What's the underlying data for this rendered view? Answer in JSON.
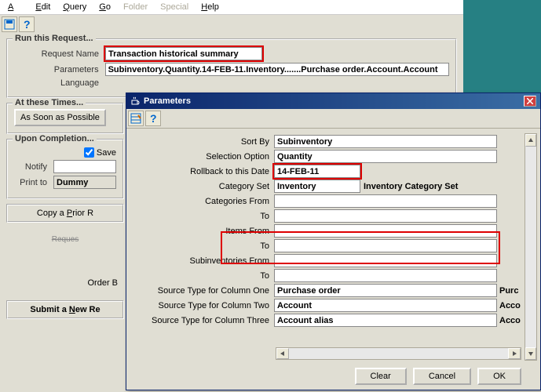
{
  "menubar": {
    "action": "Action",
    "edit": "Edit",
    "query": "Query",
    "go": "Go",
    "folder": "Folder",
    "special": "Special",
    "help": "Help"
  },
  "group_run": {
    "title": "Run this Request...",
    "request_name_label": "Request Name",
    "request_name": "Transaction historical summary",
    "parameters_label": "Parameters",
    "parameters": "Subinventory.Quantity.14-FEB-11.Inventory.......Purchase order.Account.Account",
    "language_label": "Language"
  },
  "group_times": {
    "title": "At these Times...",
    "asap": "As Soon as Possible"
  },
  "group_complete": {
    "title": "Upon Completion...",
    "save": "Save",
    "notify_label": "Notify",
    "printto_label": "Print to",
    "printto": "Dummy"
  },
  "links": {
    "copy_prior": "Copy a Prior R",
    "order_b": "Order B",
    "submit_new": "Submit a New Re",
    "clipped": "Reques"
  },
  "dialog": {
    "title": "Parameters",
    "fields": {
      "sort_by": {
        "label": "Sort By",
        "value": "Subinventory"
      },
      "selection": {
        "label": "Selection Option",
        "value": "Quantity"
      },
      "rollback": {
        "label": "Rollback to this Date",
        "value": "14-FEB-11"
      },
      "catset": {
        "label": "Category Set",
        "value": "Inventory",
        "side": "Inventory Category Set"
      },
      "cat_from": {
        "label": "Categories From",
        "value": ""
      },
      "cat_to": {
        "label": "To",
        "value": ""
      },
      "items_from": {
        "label": "Items From",
        "value": ""
      },
      "items_to": {
        "label": "To",
        "value": ""
      },
      "subinv_from": {
        "label": "Subinventories From",
        "value": ""
      },
      "subinv_to": {
        "label": "To",
        "value": ""
      },
      "src1": {
        "label": "Source Type for Column One",
        "value": "Purchase order",
        "side": "Purc"
      },
      "src2": {
        "label": "Source Type for Column Two",
        "value": "Account",
        "side": "Acco"
      },
      "src3": {
        "label": "Source Type for Column Three",
        "value": "Account alias",
        "side": "Acco"
      }
    },
    "buttons": {
      "clear": "Clear",
      "cancel": "Cancel",
      "ok": "OK"
    }
  }
}
